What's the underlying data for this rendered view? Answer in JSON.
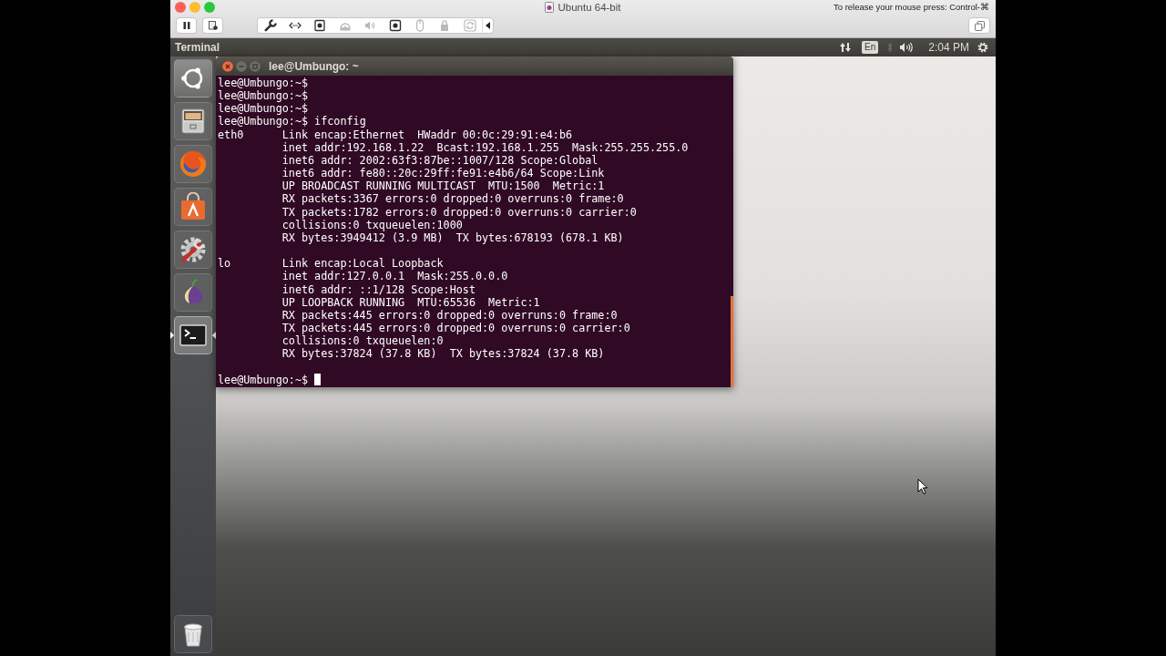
{
  "vm_window": {
    "title": "Ubuntu 64-bit",
    "release_hint": "To release your mouse press: Control-⌘"
  },
  "vm_toolbar": {
    "devices": [
      {
        "kind": "settings",
        "disabled": false
      },
      {
        "kind": "network",
        "disabled": false
      },
      {
        "kind": "disk",
        "disabled": false
      },
      {
        "kind": "optical",
        "disabled": true
      },
      {
        "kind": "sound",
        "disabled": true
      },
      {
        "kind": "camera",
        "disabled": false
      },
      {
        "kind": "mouse",
        "disabled": true
      },
      {
        "kind": "usb",
        "disabled": true
      },
      {
        "kind": "sync",
        "disabled": true
      }
    ]
  },
  "top_panel": {
    "app_name": "Terminal",
    "keyboard_layout": "En",
    "clock": "2:04 PM"
  },
  "launcher": {
    "items": [
      {
        "kind": "dash",
        "active": false
      },
      {
        "kind": "files",
        "active": false
      },
      {
        "kind": "browser",
        "active": false
      },
      {
        "kind": "software",
        "active": false
      },
      {
        "kind": "settings",
        "active": false
      },
      {
        "kind": "tor",
        "active": false
      },
      {
        "kind": "terminal",
        "active": true
      },
      {
        "kind": "trash",
        "active": false
      }
    ]
  },
  "terminal": {
    "title": "lee@Umbungo: ~",
    "prompt_lines": [
      "lee@Umbungo:~$",
      "lee@Umbungo:~$",
      "lee@Umbungo:~$",
      "lee@Umbungo:~$ ifconfig"
    ],
    "interfaces": [
      {
        "name": "eth0",
        "lines": [
          "Link encap:Ethernet  HWaddr 00:0c:29:91:e4:b6",
          "inet addr:192.168.1.22  Bcast:192.168.1.255  Mask:255.255.255.0",
          "inet6 addr: 2002:63f3:87be::1007/128 Scope:Global",
          "inet6 addr: fe80::20c:29ff:fe91:e4b6/64 Scope:Link",
          "UP BROADCAST RUNNING MULTICAST  MTU:1500  Metric:1",
          "RX packets:3367 errors:0 dropped:0 overruns:0 frame:0",
          "TX packets:1782 errors:0 dropped:0 overruns:0 carrier:0",
          "collisions:0 txqueuelen:1000",
          "RX bytes:3949412 (3.9 MB)  TX bytes:678193 (678.1 KB)"
        ]
      },
      {
        "name": "lo",
        "lines": [
          "Link encap:Local Loopback",
          "inet addr:127.0.0.1  Mask:255.0.0.0",
          "inet6 addr: ::1/128 Scope:Host",
          "UP LOOPBACK RUNNING  MTU:65536  Metric:1",
          "RX packets:445 errors:0 dropped:0 overruns:0 frame:0",
          "TX packets:445 errors:0 dropped:0 overruns:0 carrier:0",
          "collisions:0 txqueuelen:0",
          "RX bytes:37824 (37.8 KB)  TX bytes:37824 (37.8 KB)"
        ]
      }
    ],
    "final_prompt": "lee@Umbungo:~$",
    "cursor_visible": true
  }
}
